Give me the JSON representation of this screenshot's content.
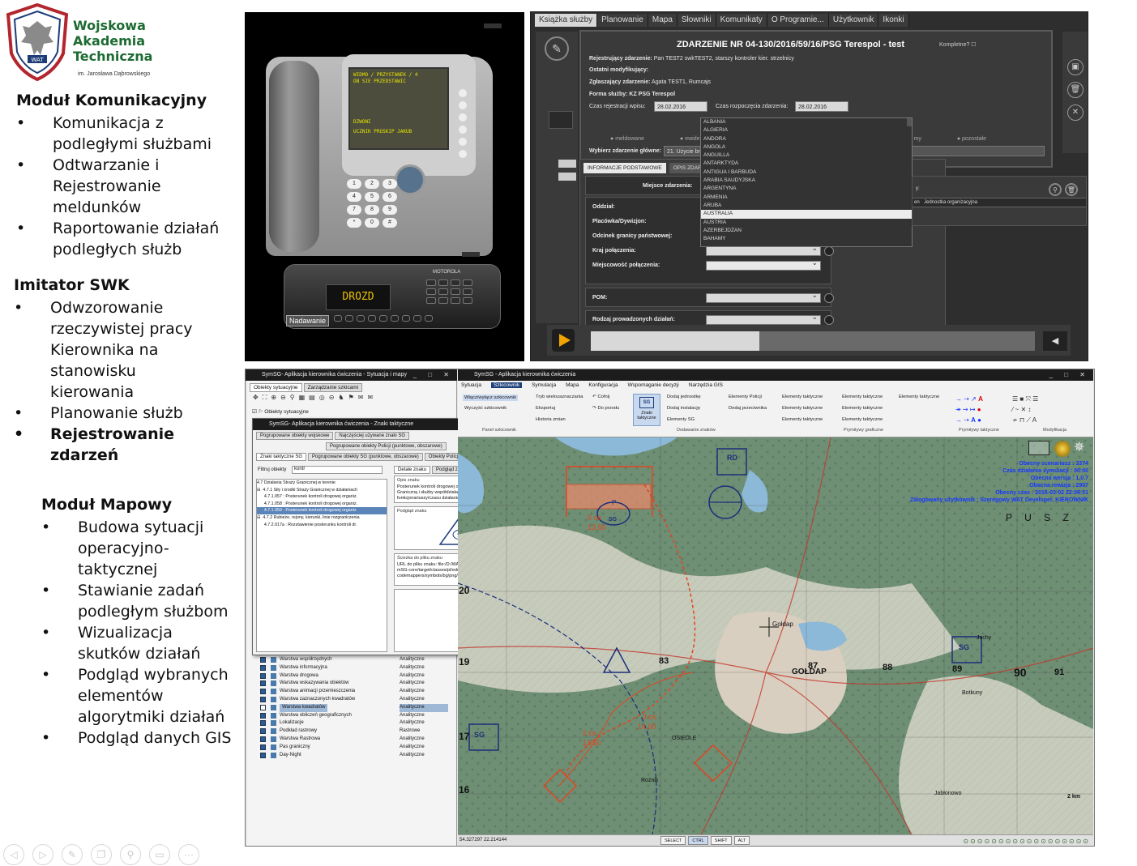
{
  "logo": {
    "line1": "Wojskowa",
    "line2": "Akademia",
    "line3": "Techniczna",
    "sub": "im. Jarosława Dąbrowskiego",
    "emblem": "WAT",
    "color": "#1d6b33"
  },
  "sections": {
    "komunikacyjny": {
      "title": "Moduł Komunikacyjny",
      "items": [
        "Komunikacja z podległymi służbami",
        "Odtwarzanie i Rejestrowanie meldunków",
        "Raportowanie działań podległych służb"
      ]
    },
    "swk": {
      "title": "Imitator SWK",
      "items": [
        "Odwzorowanie rzeczywistej pracy Kierownika na stanowisku kierowania",
        "Planowanie służb",
        "Rejestrowanie zdarzeń"
      ]
    },
    "mapowy": {
      "title": "Moduł Mapowy",
      "items": [
        "Budowa sytuacji operacyjno-taktycznej",
        "Stawianie zadań podległym służbom",
        "Wizualizacja skutków działań",
        "Podgląd wybranych elementów algorytmiki działań",
        "Podgląd danych GIS"
      ]
    }
  },
  "navbar": [
    "◁",
    "▷",
    "✎",
    "❐",
    "⚲",
    "▭",
    "···"
  ],
  "phone": {
    "screen_lines": [
      "WIDMO / PRZYSTANEK / 4",
      "ON SIE PRZEDSTAWIC"
    ],
    "screen_big": [
      "DZWONI",
      "UCZNIK PROSKIP JAKUB"
    ],
    "keys": [
      "1",
      "2",
      "3",
      "4",
      "5",
      "6",
      "7",
      "8",
      "9",
      "*",
      "0",
      "#"
    ],
    "radio_display": "DROZD",
    "radio_brand": "MOTOROLA",
    "radio_button": "Nadawanie"
  },
  "incident": {
    "menu": [
      "Książka służby",
      "Planowanie",
      "Mapa",
      "Słowniki",
      "Komunikaty",
      "O Programie...",
      "Użytkownik",
      "Ikonki"
    ],
    "title": "ZDARZENIE NR  04-130/2016/59/16/PSG Terespol - test",
    "complete_label": "Kompletne?",
    "fields": {
      "registrant_label": "Rejestrujący zdarzenie:",
      "registrant_value": "Pan TEST2 swkTEST2, starszy  kontroler kier. strzelnicy",
      "last_mod_label": "Ostatni modyfikujący:",
      "reporter_label": "Zgłaszający zdarzenie:",
      "reporter_value": "Agata TEST1, Rumcajs",
      "service_label": "Forma służby:",
      "service_value": "KZ PSG Terespol",
      "reg_time_label": "Czas rejestracji wpisu:",
      "reg_time_value": "28.02.2016",
      "start_time_label": "Czas rozpoczęcia zdarzenia:",
      "start_time_value": "28.02.2016",
      "main_event_label": "Wybierz zdarzenie główne:",
      "main_event_value": "21. Użycie bro"
    },
    "radio_options": [
      "meldowane",
      "ewide",
      "my",
      "pozostałe"
    ],
    "countries": [
      "ALBANIA",
      "ALGIERIA",
      "ANDORA",
      "ANGOLA",
      "ANGUILLA",
      "ANTARKTYDA",
      "ANTIGUA I BARBUDA",
      "ARABIA SAUDYJSKA",
      "ARGENTYNA",
      "ARMENIA",
      "ARUBA",
      "AUSTRALIA",
      "AUSTRIA",
      "AZERBEJDŻAN",
      "BAHAMY"
    ],
    "selected_country": "AUSTRALIA",
    "tabs": [
      "INFORMACJE PODSTAWOWE",
      "OPIS ZDARZEN"
    ],
    "place_label": "Miejsce zdarzenia:",
    "form_rows": {
      "oddzial": "Oddział:",
      "placowka": "Placówka/Dywizjon:",
      "odcinek": "Odcinek granicy państwowej:",
      "kraj": "Kraj połączenia:",
      "miejscowosc": "Miejscowość połączenia:",
      "pom": "POM:",
      "rodzaj": "Rodzaj prowadzonych działań:"
    },
    "side_headers": [
      "en",
      "Jednostka organizacyjna"
    ],
    "progress": 0.38
  },
  "map_app": {
    "left_title": "SymSG- Aplikacja kierownika ćwiczenia - Sytuacja i mapy",
    "right_title": "SymSG - Aplikacja kierownika ćwiczenia",
    "left_tabs": [
      "Obiekty sytuacyjne",
      "Zarządzanie szkicami"
    ],
    "tree_root": "Obiekty sytuacyjne",
    "signs_dialog": {
      "title": "SymSG- Aplikacja kierownika ćwiczenia - Znaki taktyczne",
      "row1": [
        "Pogrupowane obiekty wojskowe",
        "Najczęściej używane znaki SG"
      ],
      "row2": [
        "Pogrupowane obiekty Policji (punktowe, obszarowe)"
      ],
      "row3": [
        "Znaki taktyczne SG",
        "Pogrupowane obiekty SG (punktowe, obszarowe)",
        "Obiekty Policji"
      ],
      "filter_label": "Filtruj obiekty",
      "filter_value": "kontr",
      "tree": [
        "4.7 Działania Straży Granicznej w terenie",
        "⊟  4.7.1 Siły i środki Straży Granicznej w działaniach",
        "      4.7.1.057 : Posterunek kontroli drogowej organiz.",
        "      4.7.1.058 : Posterunek kontroli drogowej organiz.",
        "      4.7.1.059 : Posterunek kontroli drogowej organiz.",
        "⊟  4.7.2 Rubieże, rejony, kierunki, linie rozgraniczenia",
        "      4.7.2.017a : Rozstawienie posterunku kontroli dr."
      ],
      "tree_selected_index": 4,
      "detail_tabs": [
        "Detale znaku",
        "Podgląd znaku"
      ],
      "desc_caption": "Opis znaku",
      "desc_text": "Posterunek kontroli drogowej organizowanej przez Straż Graniczną i służby współdziałające - w opisie z podaniem liczby funkcjonariuszy/czasu działania",
      "preview_caption": "Podgląd znaku",
      "preview_label": "SG",
      "path_caption": "Ścieżka do pliku znaku",
      "path_text": "URL do pliku znaku: file:/D:/WAT/sym-sg-trunk/SymSG-dev/SymSG-core/target/classes/pl/edu/wat/symsg/core/symbol/semce/codemappers/symbols/bg/png/4.7.1.059.png"
    },
    "layers": [
      {
        "name": "Warstwa współrzędnych",
        "type": "Analityczne",
        "on": true
      },
      {
        "name": "Warstwa informacyjna",
        "type": "Analityczne",
        "on": true
      },
      {
        "name": "Warstwa drogowa",
        "type": "Analityczne",
        "on": true
      },
      {
        "name": "Warstwa wskazywania obiektów",
        "type": "Analityczne",
        "on": true
      },
      {
        "name": "Warstwa animacji przemieszczenia",
        "type": "Analityczne",
        "on": true
      },
      {
        "name": "Warstwa zaznaczonych kwadratów",
        "type": "Analityczne",
        "on": true
      },
      {
        "name": "Warstwa kwadratów",
        "type": "Analityczne",
        "on": false
      },
      {
        "name": "Warstwa obliczeń geograficznych",
        "type": "Analityczne",
        "on": true
      },
      {
        "name": "Lokalizacje",
        "type": "Analityczne",
        "on": true
      },
      {
        "name": "Podkład rastrowy",
        "type": "Rastrowe",
        "on": true
      },
      {
        "name": "Warstwa Rastrowa",
        "type": "Analityczne",
        "on": true
      },
      {
        "name": "Pas graniczny",
        "type": "Analityczne",
        "on": true
      },
      {
        "name": "Day-Night",
        "type": "Analityczne",
        "on": true
      }
    ],
    "highlighted_layer_index": 6,
    "ribbon_tabs": [
      "Sytuacja",
      "Szkicownik",
      "Symulacja",
      "Mapa",
      "Konfiguracja",
      "Wspomaganie decyzji",
      "Narzędzia GIS"
    ],
    "ribbon_active": "Szkicownik",
    "ribbon": {
      "col1": [
        "Włącz/wyłącz szkicownik",
        "Wyczyść szkicownik"
      ],
      "col2": [
        "Tryb wielozaznaczania",
        "Eksportuj",
        "Historia zmian"
      ],
      "col3": [
        "Cofnij",
        "Do przodu"
      ],
      "big": "Znaki taktyczne",
      "big_sign": "SG",
      "col4": [
        "Dodaj jednostkę",
        "Dodaj instalację",
        "Elementy SG"
      ],
      "col5": [
        "Elementy Policji",
        "Dodaj przeciwnika"
      ],
      "col6": [
        "Elementy taktyczne",
        "Elementy taktyczne",
        "Elementy taktyczne"
      ],
      "col7": [
        "Elementy taktyczne",
        "Elementy taktyczne",
        "Elementy taktyczne"
      ],
      "col8": [
        "Elementy taktyczne"
      ],
      "groups": [
        "Panel szkicownik",
        "Dodawanie znaków",
        "Prymitywy graficzne",
        "Prymitywy taktyczne",
        "Modyfikacja"
      ]
    },
    "map_overlay": [
      "Obecny scenariusz : 3374",
      "Czas działania symulacji : 00:00",
      "Obecna wersja : 1.0.7",
      "Obecna rewizja : 2907",
      "Obecny czas : 2016-03-02 22:06:51",
      "Zalogowany użytkownik : Szeregowy WAT Developer, KIEROWNIK"
    ],
    "map_labels": {
      "grid_left": [
        "20",
        "19",
        "18",
        "17",
        "16"
      ],
      "grid_top": [
        "83",
        "87",
        "88",
        "89",
        "90",
        "91"
      ],
      "town": "GOŁDAP",
      "place1": "Gołdap",
      "place2": "OSIEDLE",
      "place3": "Rożnik",
      "place4": "Botkuny",
      "place5": "Jabłonowo",
      "place6": "Juchy",
      "place7": "P U S Z",
      "sign_sg": "SG",
      "sign_rd": "RD",
      "sign_p": "P",
      "red1": "5 os",
      "red2": "13.50",
      "red3": "2 os",
      "red4": "13.50",
      "red5": "3 os",
      "red6": "14.00"
    },
    "scale_label": "2 km",
    "coords_label": "54.327297 22.214144",
    "status_keys": [
      "SELECT",
      "CTRL",
      "SHIFT",
      "ALT"
    ],
    "status_active": "CTRL"
  },
  "colors": {
    "accent_blue": "#1436ff",
    "sketch_red": "#e2451f",
    "map_green": "#6f8f75",
    "dark_panel": "#2e2e2e",
    "highlight": "#f0a400"
  }
}
